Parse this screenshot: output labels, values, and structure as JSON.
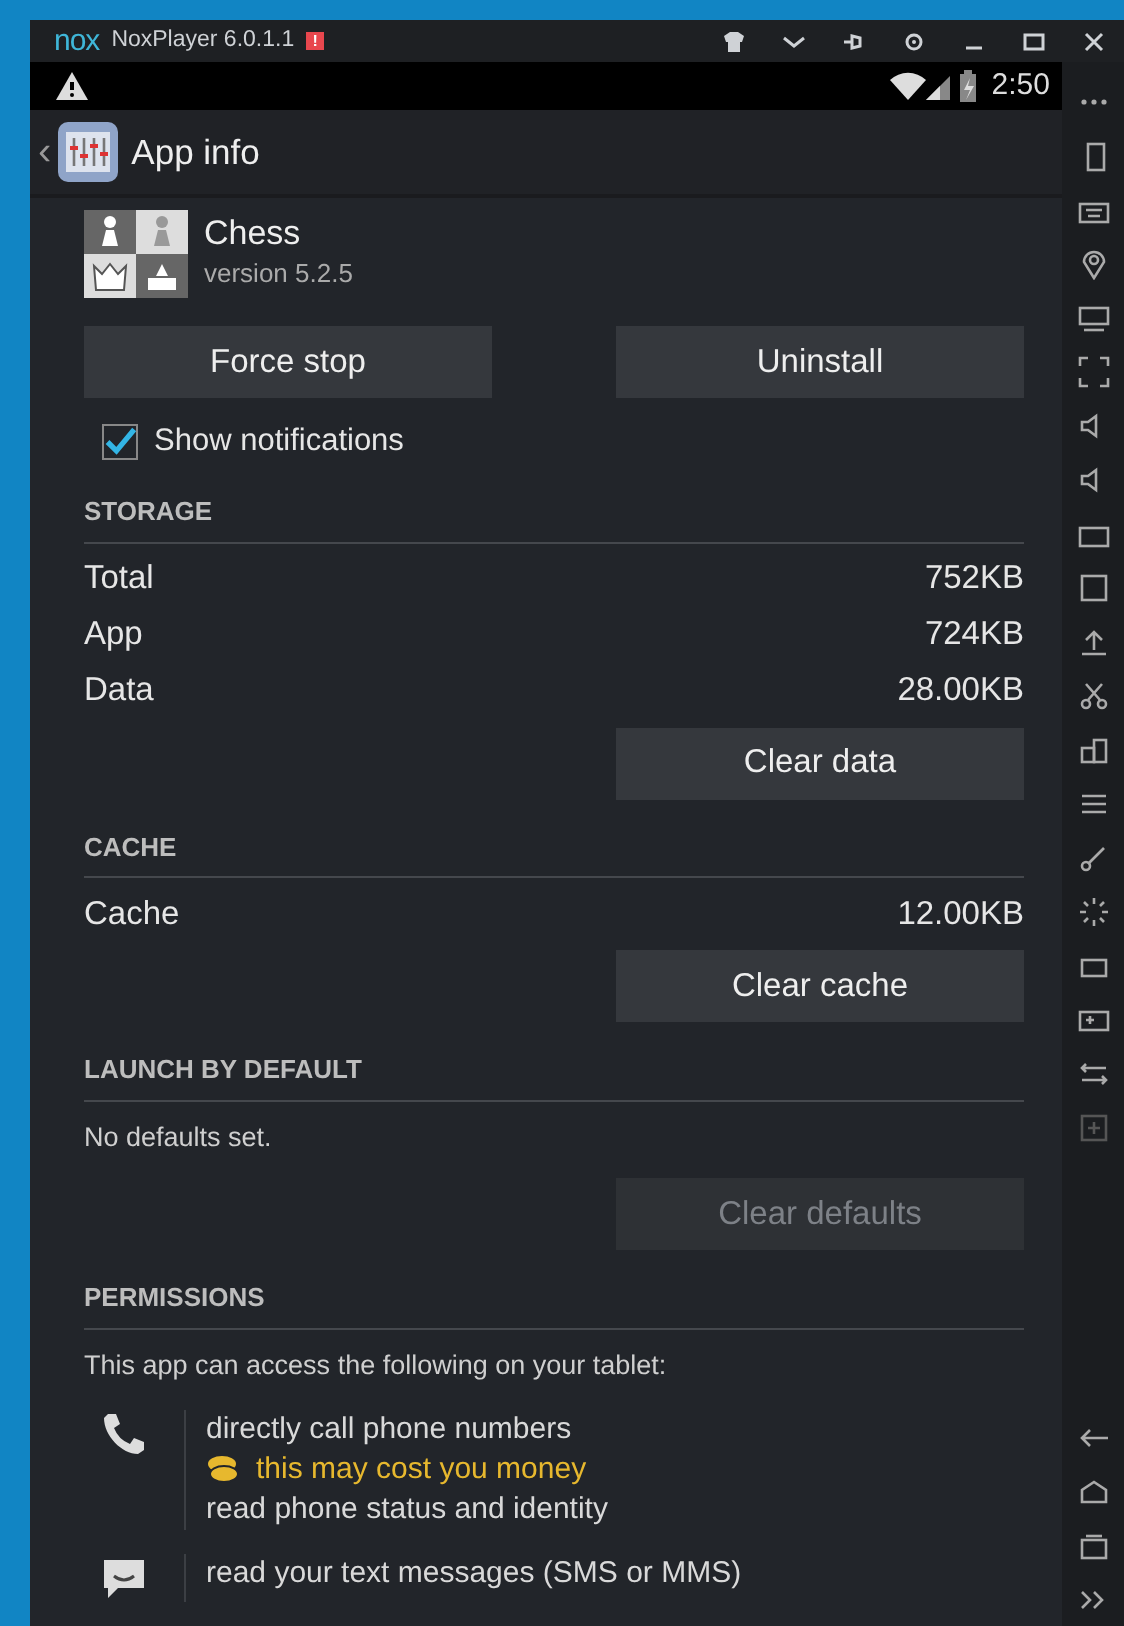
{
  "window": {
    "logo": "nox",
    "title": "NoxPlayer 6.0.1.1",
    "alert": "!"
  },
  "status_bar": {
    "time": "2:50"
  },
  "action_bar": {
    "back": "‹",
    "title": "App info"
  },
  "app": {
    "name": "Chess",
    "version": "version 5.2.5"
  },
  "buttons": [
    {
      "label": "Force stop",
      "disabled": false
    },
    {
      "label": "Uninstall",
      "disabled": false
    }
  ],
  "notifications": {
    "label": "Show notifications",
    "checked": true
  },
  "sections": [
    {
      "heading": "STORAGE",
      "rows": [
        {
          "label": "Total",
          "value": "752KB"
        },
        {
          "label": "App",
          "value": "724KB"
        },
        {
          "label": "Data",
          "value": "28.00KB"
        }
      ],
      "button": {
        "label": "Clear data",
        "disabled": false
      }
    },
    {
      "heading": "CACHE",
      "rows": [
        {
          "label": "Cache",
          "value": "12.00KB"
        }
      ],
      "button": {
        "label": "Clear cache",
        "disabled": false
      }
    },
    {
      "heading": "LAUNCH BY DEFAULT",
      "note": "No defaults set.",
      "button": {
        "label": "Clear defaults",
        "disabled": true
      }
    },
    {
      "heading": "PERMISSIONS",
      "note": "This app can access the following on your tablet:",
      "groups": [
        {
          "kind": "phone",
          "lines": [
            {
              "text": "directly call phone numbers",
              "warning": false
            },
            {
              "text": "this may cost you money",
              "warning": true
            },
            {
              "text": "read phone status and identity",
              "warning": false
            }
          ]
        },
        {
          "kind": "message",
          "lines": [
            {
              "text": "read your text messages (SMS or MMS)",
              "warning": false
            }
          ]
        }
      ]
    }
  ]
}
